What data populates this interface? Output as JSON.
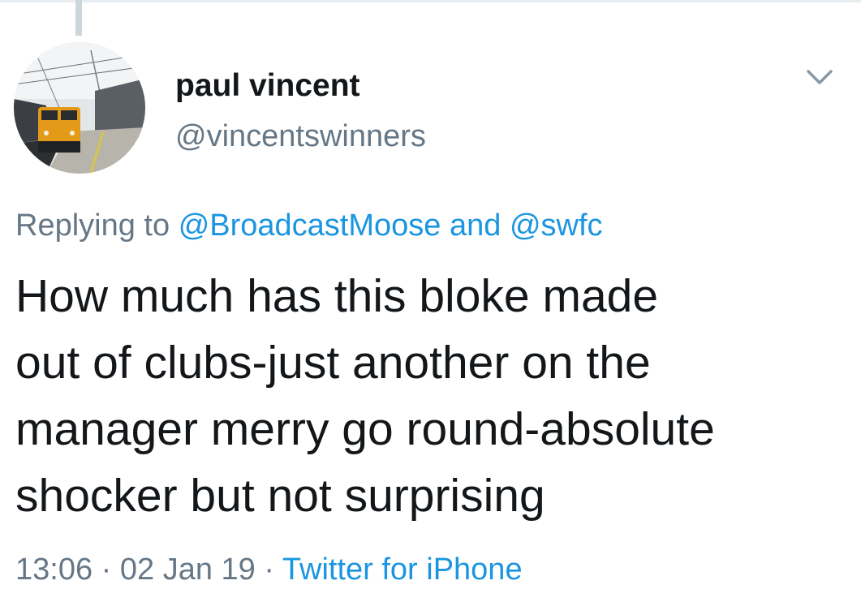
{
  "user": {
    "name": "paul vincent",
    "handle": "@vincentswinners"
  },
  "reply": {
    "prefix": "Replying to",
    "mention1": "@BroadcastMoose",
    "conjunction": "and",
    "mention2": "@swfc"
  },
  "tweet": {
    "lines": [
      "How much has this bloke made",
      "out of clubs-just another on the",
      "manager merry go round-absolute",
      "shocker but not surprising"
    ]
  },
  "meta": {
    "time": "13:06",
    "separator": "·",
    "date": "02 Jan 19",
    "source": "Twitter for iPhone"
  },
  "icons": {
    "menu": "chevron-down-icon",
    "avatar": "train-photo-avatar"
  },
  "colors": {
    "text": "#14171a",
    "secondary": "#657786",
    "link": "#1b95e0",
    "thread_line": "#ccd6dd"
  }
}
